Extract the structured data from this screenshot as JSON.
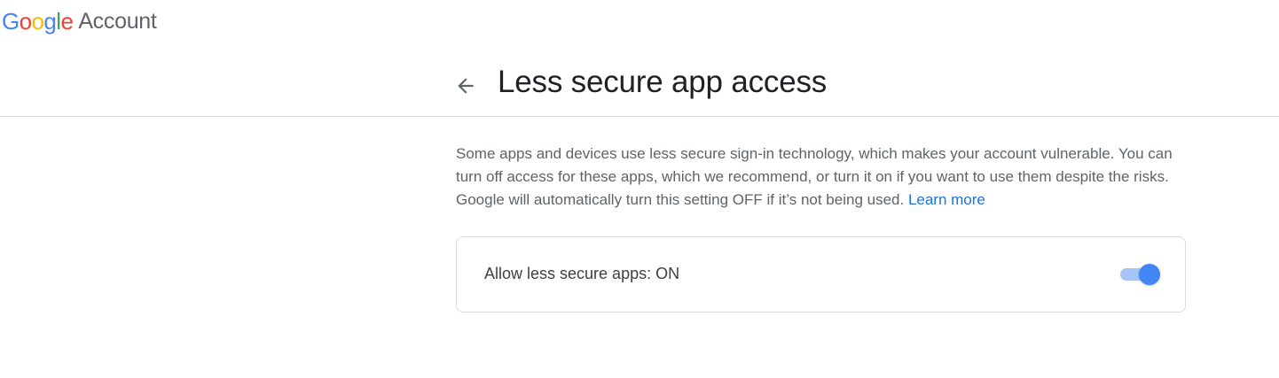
{
  "header": {
    "logo_letters": [
      {
        "char": "G",
        "color": "#4285f4"
      },
      {
        "char": "o",
        "color": "#ea4335"
      },
      {
        "char": "o",
        "color": "#fbbc05"
      },
      {
        "char": "g",
        "color": "#4285f4"
      },
      {
        "char": "l",
        "color": "#34a853"
      },
      {
        "char": "e",
        "color": "#ea4335"
      }
    ],
    "product_name": "Account"
  },
  "title_bar": {
    "back_icon": "arrow-left-icon",
    "title": "Less secure app access"
  },
  "description": {
    "text": "Some apps and devices use less secure sign-in technology, which makes your account vulnerable. You can turn off access for these apps, which we recommend, or turn it on if you want to use them despite the risks. Google will automatically turn this setting OFF if it’s not being used.",
    "link_text": "Learn more",
    "link_color": "#1a73e8"
  },
  "setting": {
    "label": "Allow less secure apps: ON",
    "toggle_on": true,
    "toggle_color": "#4285f4"
  }
}
